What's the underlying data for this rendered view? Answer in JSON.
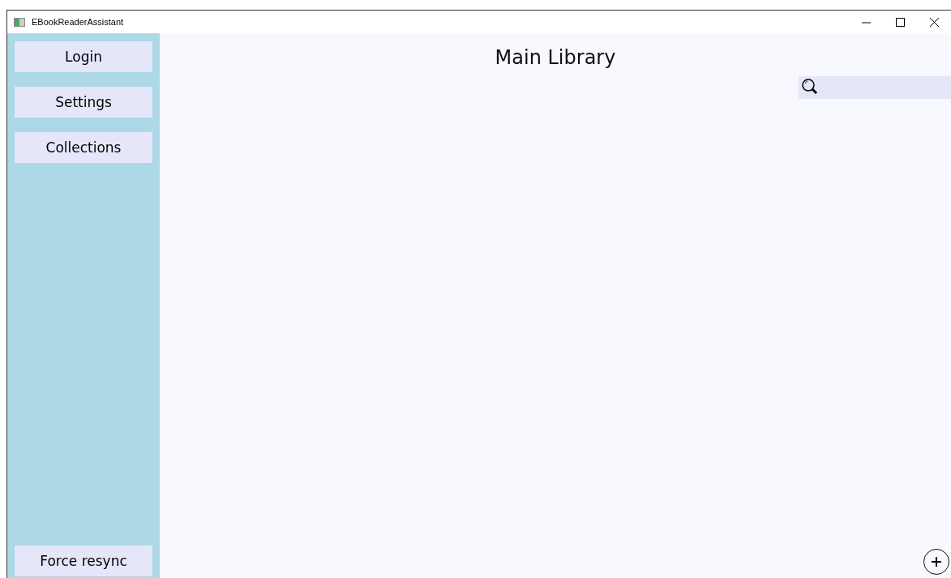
{
  "window": {
    "title": "EBookReaderAssistant"
  },
  "sidebar": {
    "top_buttons": [
      "Login",
      "Settings",
      "Collections"
    ],
    "bottom_button": "Force resync"
  },
  "main": {
    "title": "Main Library"
  }
}
